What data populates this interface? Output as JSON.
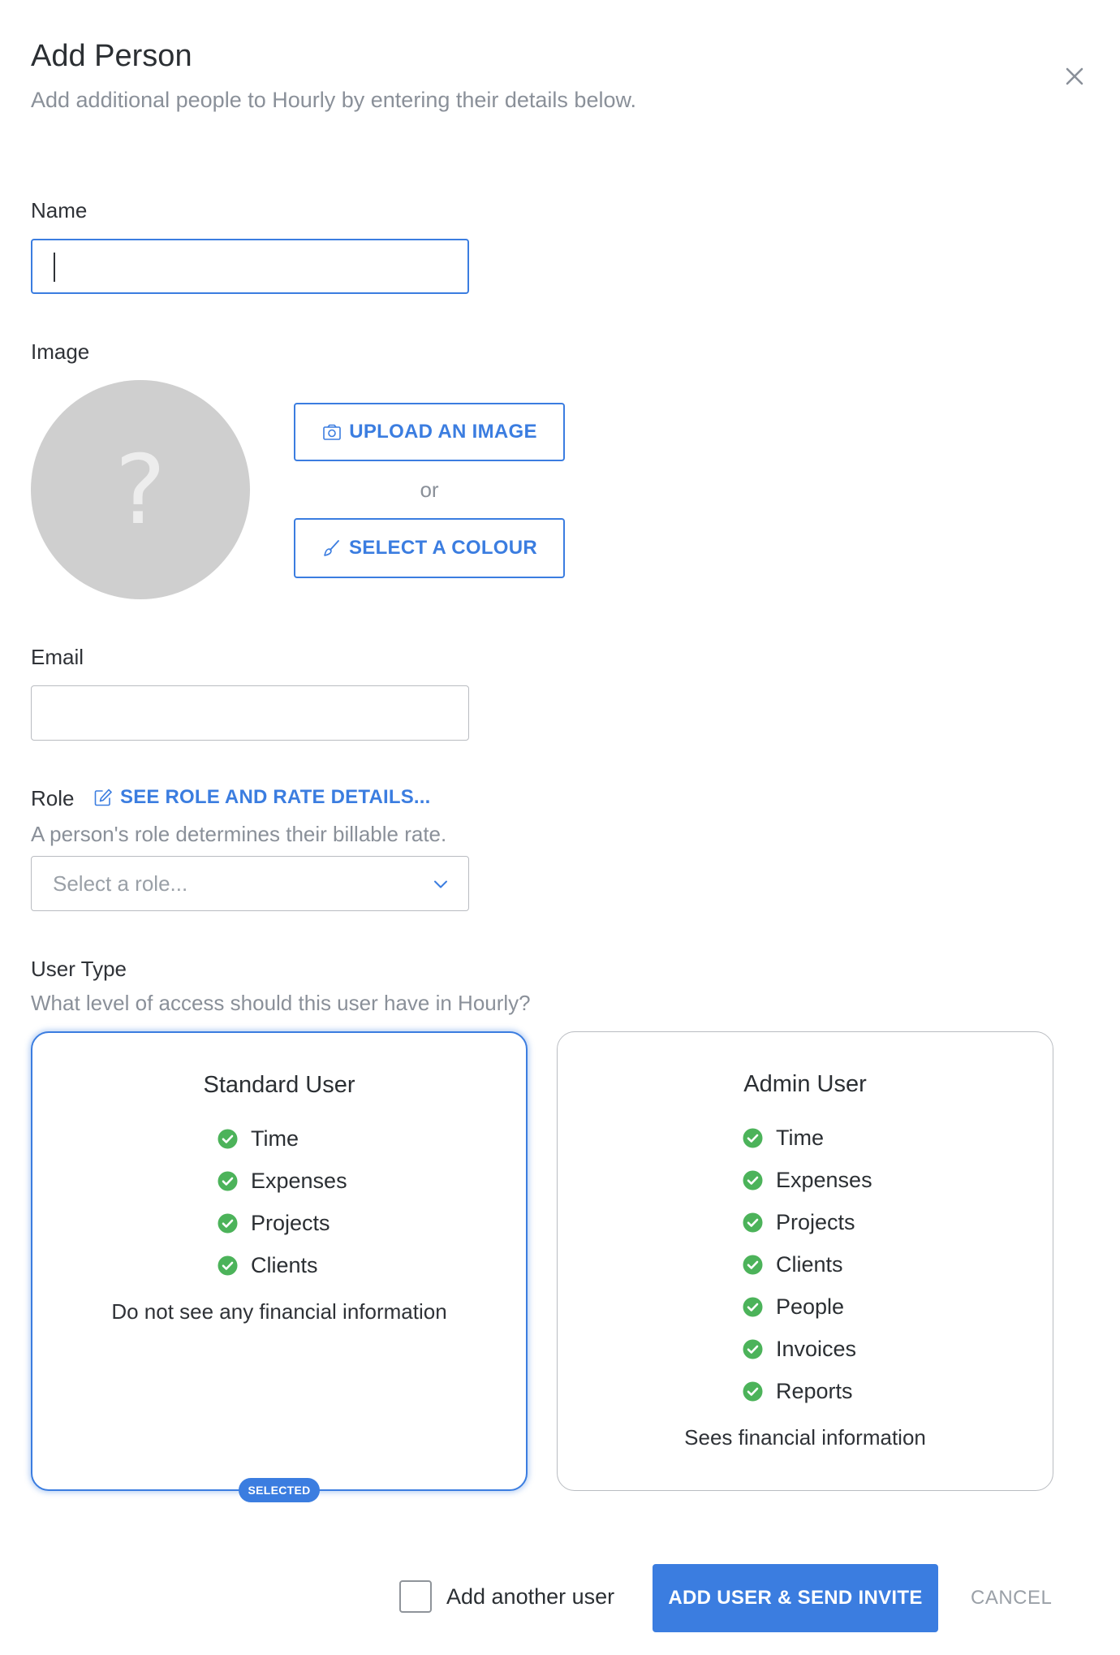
{
  "dialog": {
    "title": "Add Person",
    "subtitle": "Add additional people to Hourly by entering their details below.",
    "close_icon": "close-icon"
  },
  "name": {
    "label": "Name",
    "value": "",
    "placeholder": ""
  },
  "image": {
    "label": "Image",
    "avatar_placeholder": "?",
    "upload_label": "UPLOAD AN IMAGE",
    "upload_icon": "camera-icon",
    "or_text": "or",
    "colour_label": "SELECT A COLOUR",
    "colour_icon": "brush-icon"
  },
  "email": {
    "label": "Email",
    "value": "",
    "placeholder": ""
  },
  "role": {
    "label": "Role",
    "details_link": "SEE ROLE AND RATE DETAILS...",
    "details_icon": "edit-icon",
    "help": "A person's role determines their billable rate.",
    "select_placeholder": "Select a role...",
    "chevron_icon": "chevron-down-icon"
  },
  "user_type": {
    "label": "User Type",
    "help": "What level of access should this user have in Hourly?",
    "selected": "standard",
    "standard": {
      "title": "Standard User",
      "features": [
        "Time",
        "Expenses",
        "Projects",
        "Clients"
      ],
      "note": "Do not see any financial information",
      "badge": "SELECTED"
    },
    "admin": {
      "title": "Admin User",
      "features": [
        "Time",
        "Expenses",
        "Projects",
        "Clients",
        "People",
        "Invoices",
        "Reports"
      ],
      "note": "Sees financial information"
    }
  },
  "footer": {
    "add_another_label": "Add another user",
    "add_another_checked": false,
    "submit_label": "ADD USER & SEND INVITE",
    "cancel_label": "CANCEL"
  },
  "colors": {
    "accent": "#3b7de0",
    "check_green": "#4cb35a",
    "muted_text": "#8a9099",
    "border": "#b9bcc1",
    "avatar_bg": "#cfcfcf"
  }
}
